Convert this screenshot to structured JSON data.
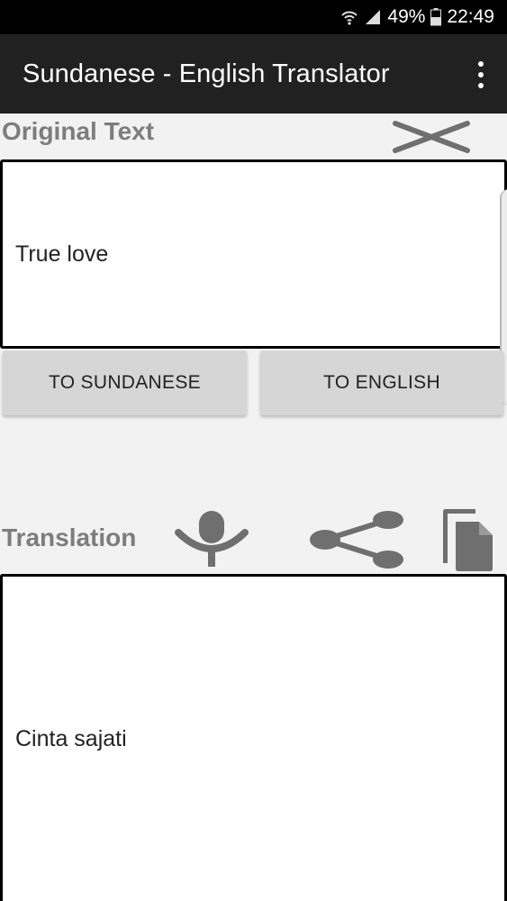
{
  "status_bar": {
    "battery": "49%",
    "time": "22:49"
  },
  "app_bar": {
    "title": "Sundanese - English Translator"
  },
  "original": {
    "label": "Original Text",
    "value": "True love"
  },
  "actions": {
    "to_sundanese": "TO SUNDANESE",
    "to_english": "TO ENGLISH"
  },
  "translation": {
    "label": "Translation",
    "value": "Cinta sajati"
  },
  "icons": {
    "clear": "clear-icon",
    "mic": "mic-icon",
    "share": "share-icon",
    "copy": "copy-icon",
    "overflow": "overflow-menu-icon"
  },
  "colors": {
    "app_bar": "#212121",
    "label_gray": "#7d7d7d",
    "button_bg": "#d6d6d6",
    "icon_gray": "#6f6f6f"
  }
}
